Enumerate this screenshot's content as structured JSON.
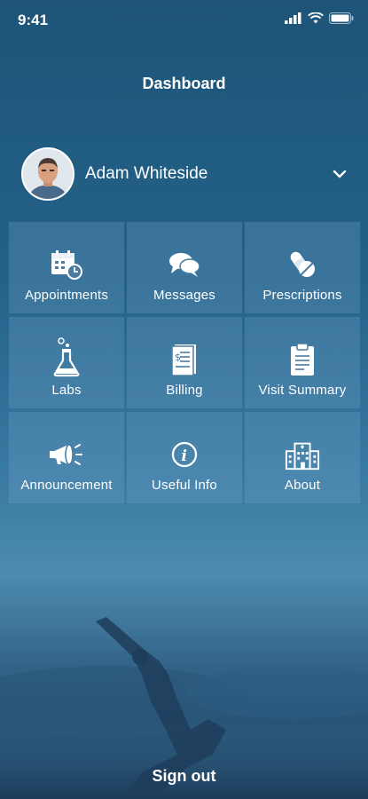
{
  "status_bar": {
    "time": "9:41"
  },
  "header": {
    "title": "Dashboard"
  },
  "user": {
    "name": "Adam Whiteside"
  },
  "tiles": [
    {
      "label": "Appointments",
      "icon": "calendar-clock-icon"
    },
    {
      "label": "Messages",
      "icon": "chat-bubbles-icon"
    },
    {
      "label": "Prescriptions",
      "icon": "pills-icon"
    },
    {
      "label": "Labs",
      "icon": "flask-icon"
    },
    {
      "label": "Billing",
      "icon": "invoice-icon"
    },
    {
      "label": "Visit Summary",
      "icon": "clipboard-icon"
    },
    {
      "label": "Announcement",
      "icon": "megaphone-icon"
    },
    {
      "label": "Useful Info",
      "icon": "info-icon"
    },
    {
      "label": "About",
      "icon": "hospital-icon"
    }
  ],
  "footer": {
    "sign_out": "Sign out"
  }
}
